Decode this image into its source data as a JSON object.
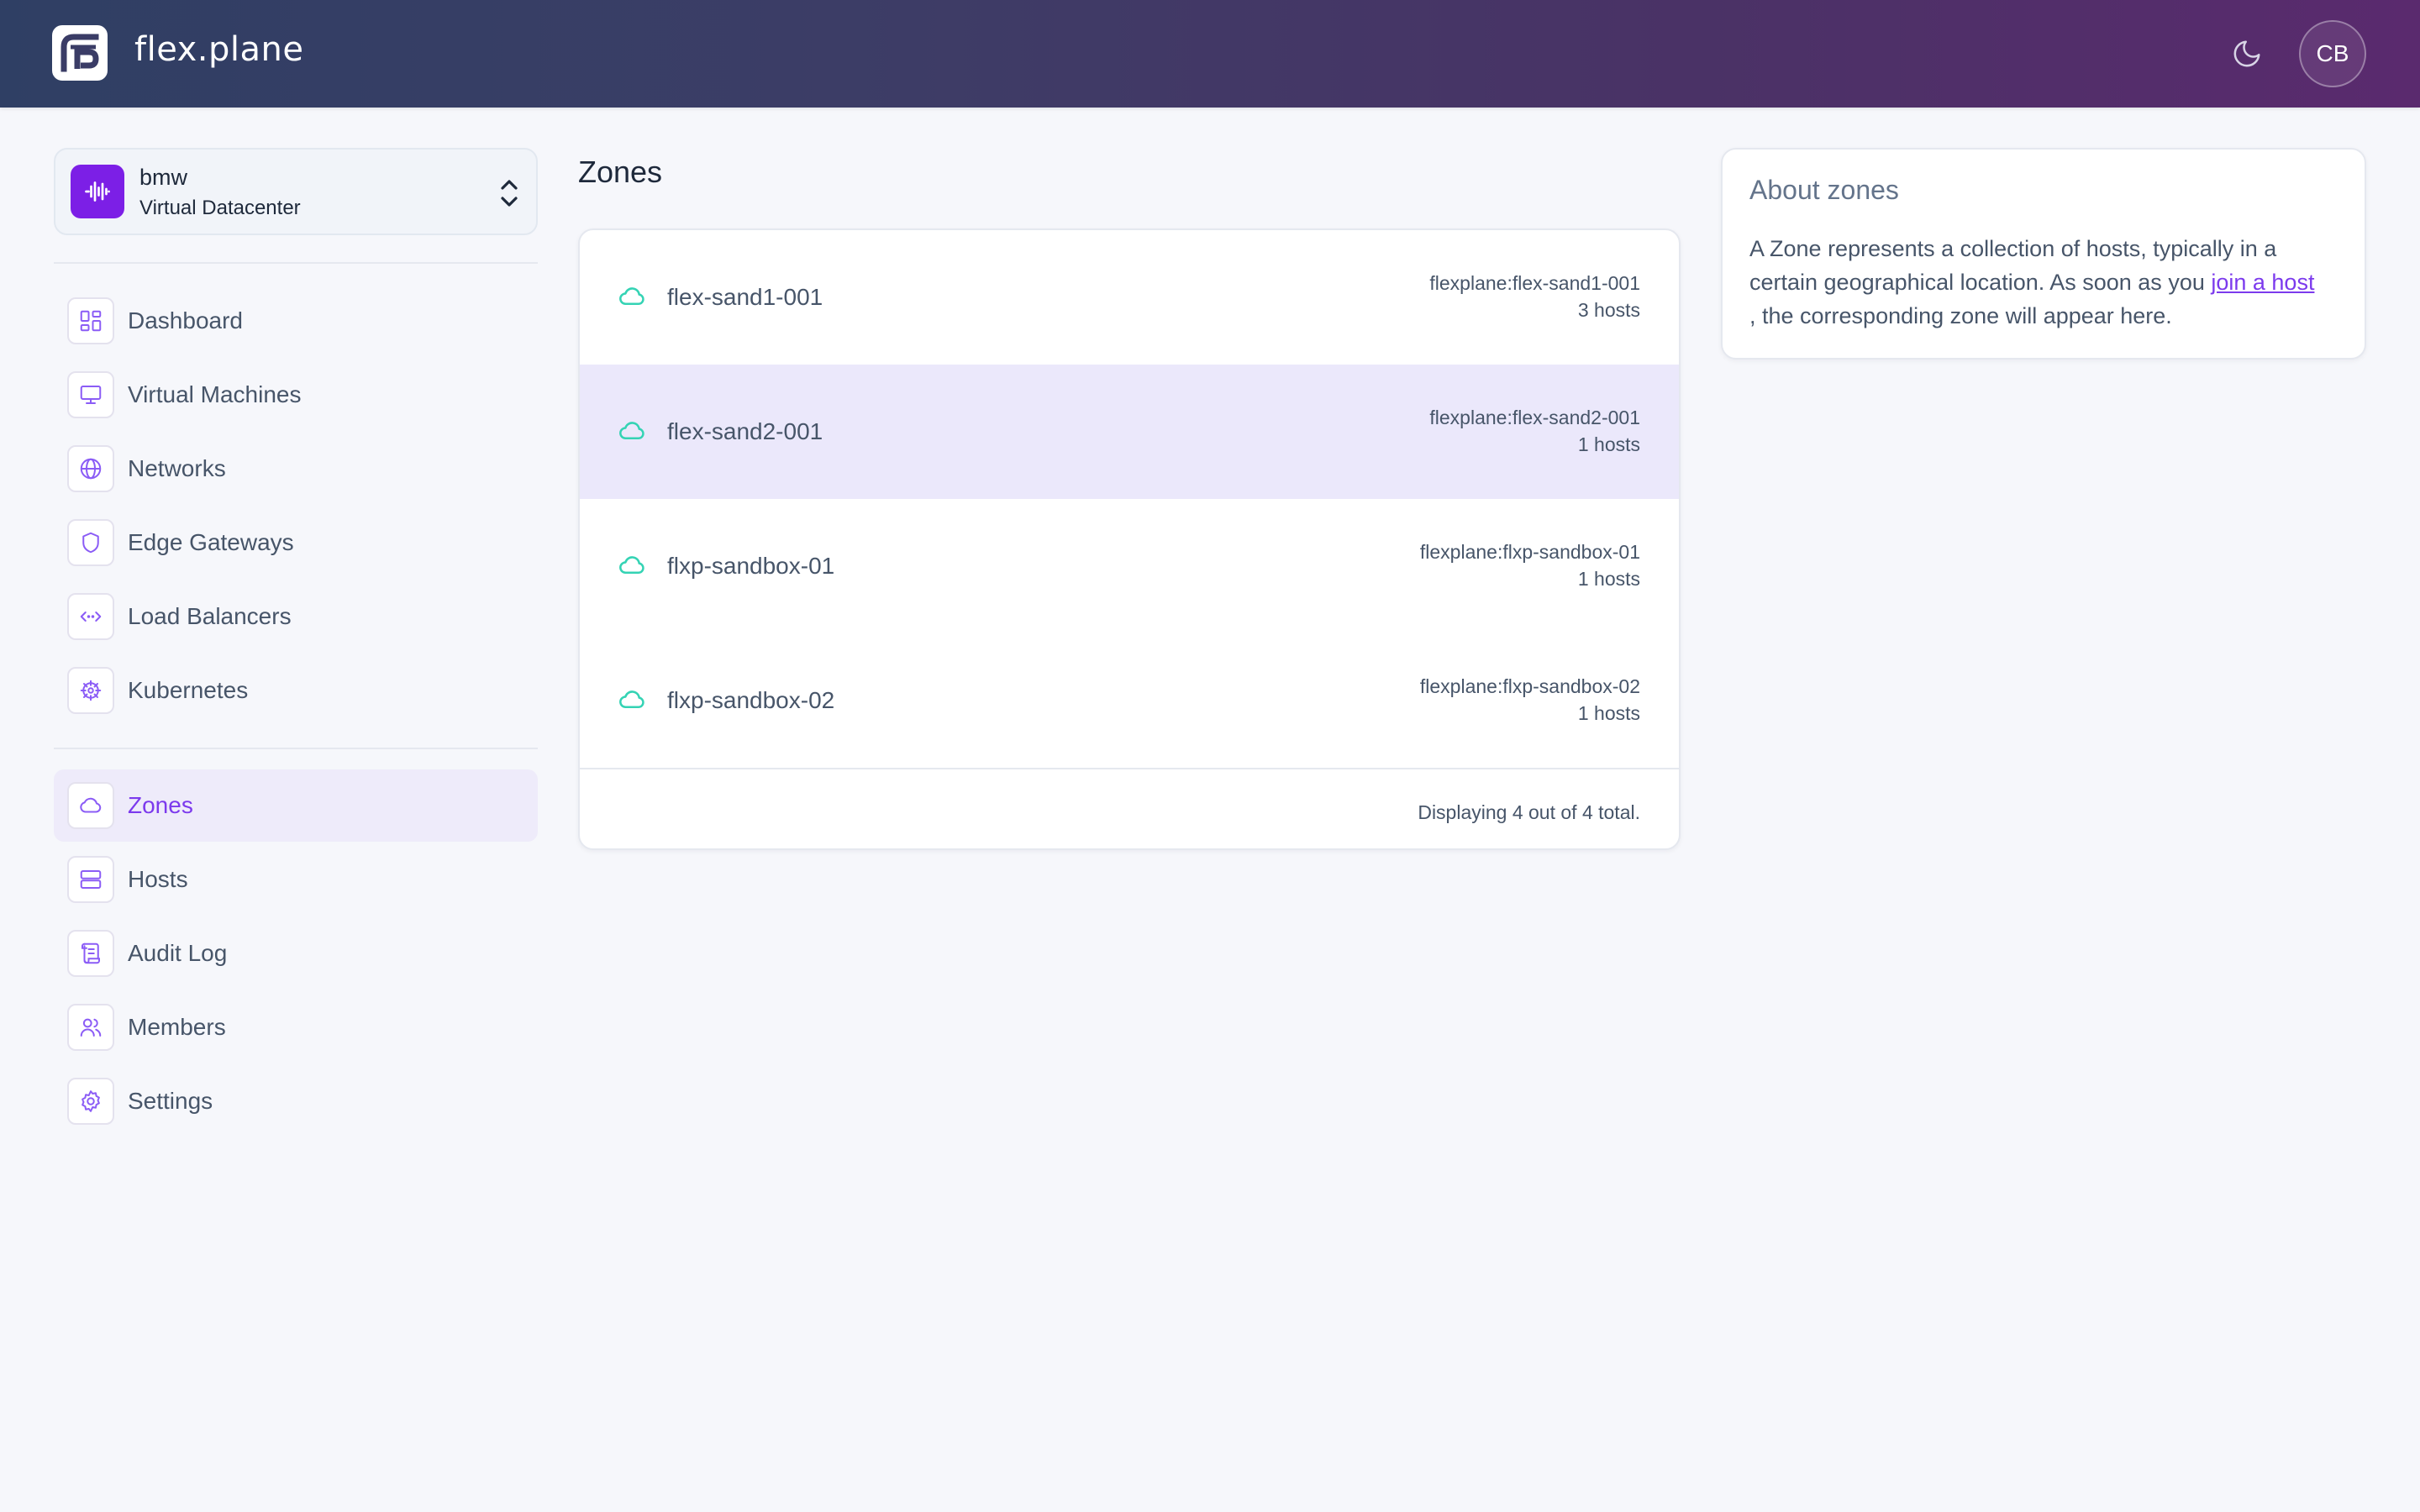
{
  "app": {
    "brand": "flex.plane",
    "avatar_initials": "CB",
    "colors": {
      "accent": "#7c3aed",
      "zone_icon": "#34d3b4",
      "org_icon_bg": "#7c1fe6"
    }
  },
  "org": {
    "name": "bmw",
    "type": "Virtual Datacenter"
  },
  "sidebar": {
    "primary": [
      {
        "label": "Dashboard",
        "icon": "dashboard-icon"
      },
      {
        "label": "Virtual Machines",
        "icon": "monitor-icon"
      },
      {
        "label": "Networks",
        "icon": "globe-icon"
      },
      {
        "label": "Edge Gateways",
        "icon": "shield-icon"
      },
      {
        "label": "Load Balancers",
        "icon": "code-icon"
      },
      {
        "label": "Kubernetes",
        "icon": "helm-icon"
      }
    ],
    "secondary": [
      {
        "label": "Zones",
        "icon": "cloud-icon",
        "active": true
      },
      {
        "label": "Hosts",
        "icon": "server-icon"
      },
      {
        "label": "Audit Log",
        "icon": "scroll-icon"
      },
      {
        "label": "Members",
        "icon": "users-icon"
      },
      {
        "label": "Settings",
        "icon": "gear-icon"
      }
    ]
  },
  "main": {
    "title": "Zones",
    "zones": [
      {
        "name": "flex-sand1-001",
        "id": "flexplane:flex-sand1-001",
        "hosts": "3 hosts"
      },
      {
        "name": "flex-sand2-001",
        "id": "flexplane:flex-sand2-001",
        "hosts": "1 hosts"
      },
      {
        "name": "flxp-sandbox-01",
        "id": "flexplane:flxp-sandbox-01",
        "hosts": "1 hosts"
      },
      {
        "name": "flxp-sandbox-02",
        "id": "flexplane:flxp-sandbox-02",
        "hosts": "1 hosts"
      }
    ],
    "footer": "Displaying 4 out of 4 total."
  },
  "about": {
    "title": "About zones",
    "text_before": "A Zone represents a collection of hosts, typically in a certain geographical location. As soon as you ",
    "link": "join a host",
    "text_after": ", the corresponding zone will appear here."
  }
}
